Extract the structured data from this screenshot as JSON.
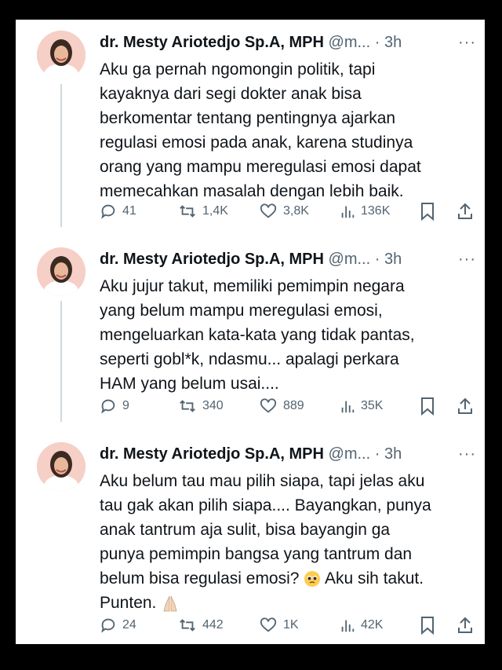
{
  "tweets": [
    {
      "name": "dr. Mesty Ariotedjo Sp.A, MPH",
      "handle": "@m...",
      "time": "· 3h",
      "more": "···",
      "lines": [
        "Aku ga pernah ngomongin politik, tapi",
        "kayaknya dari segi dokter anak bisa",
        "berkomentar tentang pentingnya ajarkan",
        "regulasi emosi pada anak, karena studinya",
        "orang yang mampu meregulasi emosi dapat",
        "memecahkan masalah dengan lebih baik."
      ],
      "replies": "41",
      "retweets": "1,4K",
      "likes": "3,8K",
      "views": "136K"
    },
    {
      "name": "dr. Mesty Ariotedjo Sp.A, MPH",
      "handle": "@m...",
      "time": "· 3h",
      "more": "···",
      "lines": [
        "Aku jujur takut, memiliki pemimpin negara",
        "yang belum mampu meregulasi emosi,",
        "mengeluarkan kata-kata yang tidak pantas,",
        "seperti gobl*k, ndasmu... apalagi perkara",
        "HAM yang belum usai...."
      ],
      "replies": "9",
      "retweets": "340",
      "likes": "889",
      "views": "35K"
    },
    {
      "name": "dr. Mesty Ariotedjo Sp.A, MPH",
      "handle": "@m...",
      "time": "· 3h",
      "more": "···",
      "lines": [
        "Aku belum tau mau pilih siapa, tapi jelas aku",
        "tau gak akan pilih siapa.... Bayangkan, punya",
        "anak tantrum aja sulit, bisa bayangin ga",
        "punya pemimpin bangsa yang tantrum dan"
      ],
      "line5_before_emoji": "belum bisa regulasi emosi?",
      "line5_after_emoji": "Aku sih takut.",
      "line6": "Punten.",
      "emoji_1": "pleading-face-emoji",
      "emoji_2": "folded-hands-emoji",
      "replies": "24",
      "retweets": "442",
      "likes": "1K",
      "views": "42K"
    }
  ],
  "colors": {
    "text": "#0f1419",
    "secondary": "#536471",
    "thread_line": "#cfd9de",
    "background": "#ffffff",
    "frame": "#000000"
  },
  "icons": [
    "reply-icon",
    "retweet-icon",
    "like-icon",
    "views-icon",
    "bookmark-icon",
    "share-icon",
    "more-icon"
  ]
}
